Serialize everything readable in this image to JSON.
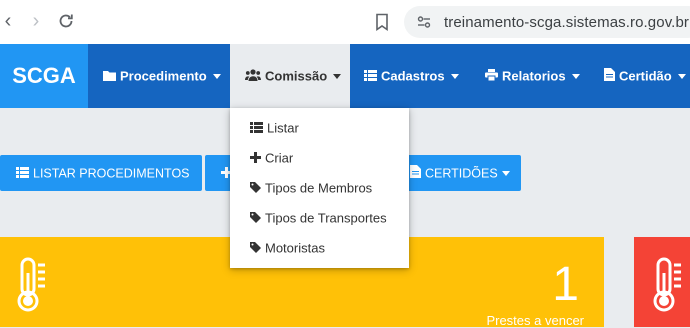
{
  "browser": {
    "url": "treinamento-scga.sistemas.ro.gov.br"
  },
  "navbar": {
    "brand": "SCGA",
    "items": [
      {
        "label": "Procedimento",
        "icon": "folder-icon"
      },
      {
        "label": "Comissão",
        "icon": "users-icon"
      },
      {
        "label": "Cadastros",
        "icon": "list-icon"
      },
      {
        "label": "Relatorios",
        "icon": "print-icon"
      },
      {
        "label": "Certidão",
        "icon": "file-icon"
      }
    ]
  },
  "dropdown": {
    "items": [
      {
        "label": "Listar",
        "icon": "list-icon"
      },
      {
        "label": "Criar",
        "icon": "plus-icon"
      },
      {
        "label": "Tipos de Membros",
        "icon": "tag-icon"
      },
      {
        "label": "Tipos de Transportes",
        "icon": "tag-icon"
      },
      {
        "label": "Motoristas",
        "icon": "tag-icon"
      }
    ]
  },
  "actions": {
    "list_procedures": "LISTAR PROCEDIMENTOS",
    "certificates": "CERTIDÕES"
  },
  "stats": {
    "due_soon_count": "1",
    "due_soon_label": "Prestes a vencer"
  },
  "colors": {
    "navbar": "#1565c0",
    "brand": "#2196f3",
    "button": "#2196f3",
    "card_warning": "#ffc107",
    "card_danger": "#f44336"
  }
}
